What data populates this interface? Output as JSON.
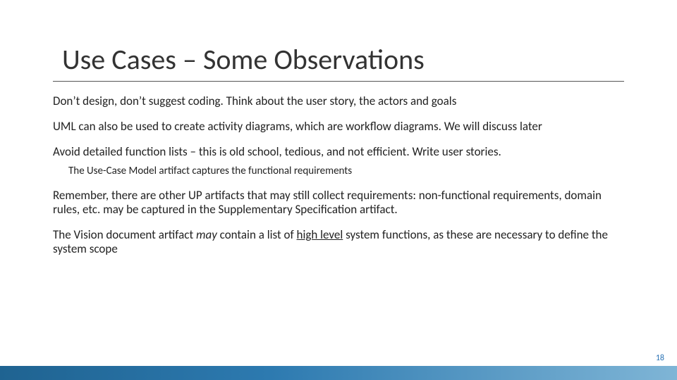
{
  "title": "Use Cases – Some Observations",
  "paragraphs": {
    "p1": "Don’t design, don’t suggest coding. Think about the user story, the actors and goals",
    "p2": "UML can also be used to create activity diagrams, which are workflow diagrams. We will discuss later",
    "p3": "Avoid detailed function lists – this is old school, tedious, and not efficient. Write user stories.",
    "p3a": "The Use-Case Model artifact captures the functional requirements",
    "p4": "Remember, there are other UP artifacts that may still collect requirements: non-functional requirements, domain rules, etc. may be captured in the Supplementary Specification artifact.",
    "p5_a": "The Vision document artifact ",
    "p5_may": "may",
    "p5_b": " contain a list of ",
    "p5_hl": "high level",
    "p5_c": " system functions, as these are necessary to define the system scope"
  },
  "page_number": "18"
}
